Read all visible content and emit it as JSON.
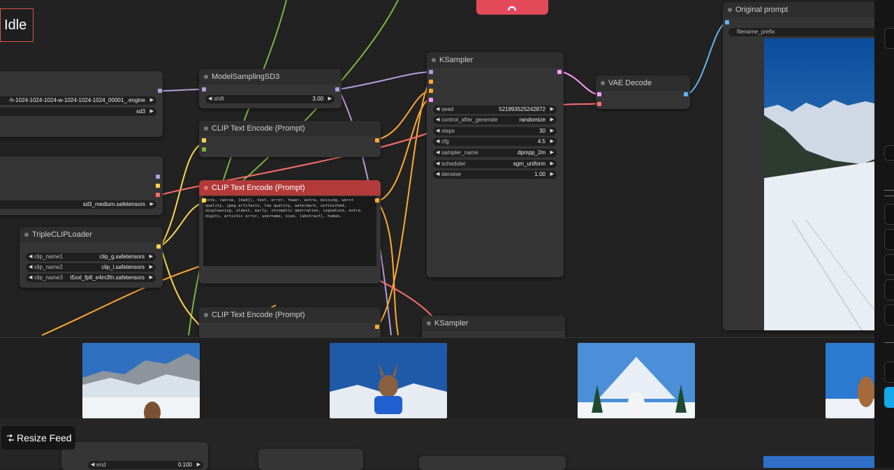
{
  "status": {
    "label": "Idle"
  },
  "feed": {
    "resize_label": "Resize Feed"
  },
  "nodes": {
    "checkpoint": {
      "widgets": [
        {
          "value": "-h-1024-1024-1024-w-1024-1024-1024_00001_.engine"
        },
        {
          "value": "sd3"
        }
      ]
    },
    "loader2": {
      "widgets": [
        {
          "value": "sd3_medium.safetensors"
        }
      ]
    },
    "triple_clip": {
      "title": "TripleCLIPLoader",
      "widgets": [
        {
          "name": "clip_name1",
          "value": "clip_g.safetensors"
        },
        {
          "name": "clip_name2",
          "value": "clip_l.safetensors"
        },
        {
          "name": "clip_name3",
          "value": "t5xxl_fp8_e4m3fn.safetensors"
        }
      ]
    },
    "model_sampling": {
      "title": "ModelSamplingSD3",
      "widgets": [
        {
          "name": "shift",
          "value": "3.00"
        }
      ]
    },
    "clip_text_1": {
      "title": "CLIP Text Encode (Prompt)"
    },
    "clip_text_2": {
      "title": "CLIP Text Encode (Prompt)",
      "text": "note, (worse, [bad]), text, error, fewer, extra, missing, worst quality, jpeg artifacts, low quality, watermark, unfinished, displeasing, oldest, early, chromatic aberration, signature, extra digits, artistic error, username, scan, [abstract], human,"
    },
    "clip_text_3": {
      "title": "CLIP Text Encode (Prompt)"
    },
    "ksampler": {
      "title": "KSampler",
      "widgets": [
        {
          "name": "seed",
          "value": "521893525242872"
        },
        {
          "name": "control_after_generate",
          "value": "randomize"
        },
        {
          "name": "steps",
          "value": "30"
        },
        {
          "name": "cfg",
          "value": "4.5"
        },
        {
          "name": "sampler_name",
          "value": "dpmpp_2m"
        },
        {
          "name": "scheduler",
          "value": "sgm_uniform"
        },
        {
          "name": "denoise",
          "value": "1.00"
        }
      ]
    },
    "ksampler2": {
      "title": "KSampler"
    },
    "vae_decode": {
      "title": "VAE Decode"
    },
    "original_prompt": {
      "title": "Original prompt",
      "widgets": [
        {
          "value": "filename_prefix"
        }
      ]
    },
    "bottom_node": {
      "widgets": [
        {
          "name": "end",
          "value": "0.100"
        }
      ]
    }
  },
  "colors": {
    "canvas": "#222222",
    "node": "#353535",
    "error_title": "#b33a3a",
    "accent_tab": "#e34a59",
    "wire_model": "#b39ddb",
    "wire_clip": "#ffd54f",
    "wire_cond": "#ffa931",
    "wire_latent": "#ff9cf9",
    "wire_vae": "#ff6e6e",
    "wire_image": "#64b5f6",
    "wire_green": "#7cb342"
  }
}
